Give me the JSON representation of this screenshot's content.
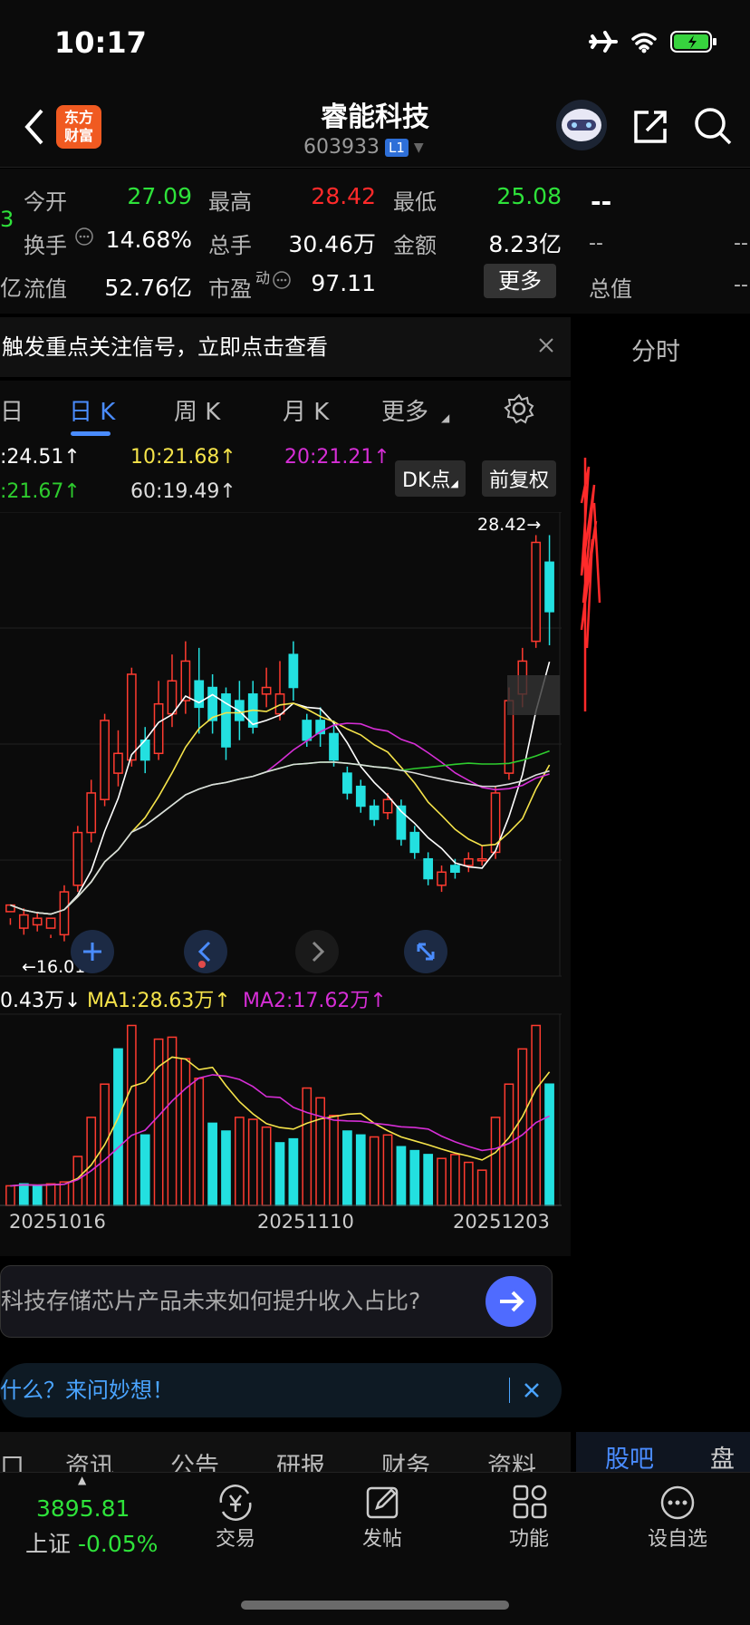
{
  "status": {
    "time": "10:17"
  },
  "header": {
    "logo_line1": "东方",
    "logo_line2": "财富",
    "title": "睿能科技",
    "code": "603933",
    "level_badge": "L1"
  },
  "quote": {
    "open_label": "今开",
    "open": "27.09",
    "high_label": "最高",
    "high": "28.42",
    "low_label": "最低",
    "low": "25.08",
    "turnover_label": "换手",
    "turnover": "14.68%",
    "volume_label": "总手",
    "volume": "30.46万",
    "amount_label": "金额",
    "amount": "8.23亿",
    "float_label": "流值",
    "float_value": "52.76亿",
    "pe_label": "市盈",
    "pe_sup": "动",
    "pe": "97.11",
    "more_label": "更多",
    "left_edge_1": "3",
    "left_edge_2": "亿",
    "side_dash": "--",
    "side_dash2": "--",
    "side_total_label": "总值",
    "side_dash3": "--",
    "side_dash4": "--"
  },
  "banner": {
    "text": "触发重点关注信号，立即点击查看"
  },
  "tabs": {
    "t0": "日",
    "t1": "日 K",
    "t2": "周 K",
    "t3": "月 K",
    "t4": "更多",
    "side": "分时"
  },
  "ma": {
    "ma5": ":24.51↑",
    "ma10": "10:21.68↑",
    "ma20": "20:21.21↑",
    "ma30": ":21.67↑",
    "ma60": "60:19.49↑",
    "dk": "DK点",
    "fq": "前复权"
  },
  "chart": {
    "max_label": "28.42→",
    "min_label": "←16.01",
    "vol_ma0": "0.43万↓",
    "vol_ma1": "MA1:28.63万↑",
    "vol_ma2": "MA2:17.62万↑",
    "date1": "20251016",
    "date2": "20251110",
    "date3": "20251203"
  },
  "chart_data": {
    "type": "candlestick",
    "price_high": 28.42,
    "price_low": 16.01,
    "candles": [
      [
        17.0,
        17.2,
        16.8,
        16.6
      ],
      [
        16.5,
        16.9,
        17.1,
        16.3
      ],
      [
        16.6,
        16.8,
        17.0,
        16.4
      ],
      [
        16.5,
        16.8,
        16.2,
        16.3
      ],
      [
        16.3,
        17.6,
        17.8,
        16.1
      ],
      [
        17.8,
        19.4,
        19.6,
        17.6
      ],
      [
        19.4,
        20.6,
        21.0,
        19.1
      ],
      [
        20.4,
        22.8,
        23.0,
        20.2
      ],
      [
        21.2,
        21.8,
        22.5,
        20.8
      ],
      [
        21.6,
        24.2,
        24.4,
        21.4
      ],
      [
        22.2,
        21.6,
        22.6,
        21.2
      ],
      [
        21.8,
        23.3,
        24.0,
        21.6
      ],
      [
        23.0,
        24.0,
        24.8,
        22.6
      ],
      [
        23.4,
        24.6,
        25.2,
        23.0
      ],
      [
        24.0,
        23.2,
        25.0,
        22.4
      ],
      [
        23.8,
        22.8,
        24.2,
        22.4
      ],
      [
        23.6,
        22.0,
        23.8,
        21.6
      ],
      [
        23.4,
        22.8,
        24.0,
        22.2
      ],
      [
        23.6,
        22.6,
        24.0,
        22.4
      ],
      [
        23.6,
        23.8,
        24.4,
        23.2
      ],
      [
        23.0,
        23.6,
        24.6,
        22.8
      ],
      [
        24.8,
        23.8,
        25.2,
        23.4
      ],
      [
        22.8,
        22.2,
        23.0,
        22.0
      ],
      [
        22.8,
        22.4,
        23.2,
        22.0
      ],
      [
        22.4,
        21.6,
        22.8,
        21.4
      ],
      [
        21.2,
        20.6,
        21.4,
        20.4
      ],
      [
        20.8,
        20.2,
        21.0,
        20.0
      ],
      [
        20.2,
        19.8,
        20.4,
        19.6
      ],
      [
        20.0,
        20.4,
        20.6,
        19.8
      ],
      [
        20.2,
        19.2,
        20.4,
        19.0
      ],
      [
        19.4,
        18.8,
        19.6,
        18.6
      ],
      [
        18.6,
        18.0,
        18.8,
        17.8
      ],
      [
        17.8,
        18.2,
        18.4,
        17.6
      ],
      [
        18.4,
        18.2,
        18.6,
        18.0
      ],
      [
        18.4,
        18.6,
        18.8,
        18.2
      ],
      [
        18.6,
        18.6,
        19.0,
        18.4
      ],
      [
        18.8,
        20.6,
        20.8,
        18.6
      ],
      [
        21.2,
        23.4,
        23.8,
        21.0
      ],
      [
        23.6,
        24.6,
        25.0,
        23.2
      ],
      [
        25.2,
        28.2,
        28.42,
        25.0
      ],
      [
        27.6,
        26.1,
        28.42,
        25.08
      ]
    ],
    "volume": [
      [
        10,
        "up"
      ],
      [
        11,
        "down"
      ],
      [
        10,
        "down"
      ],
      [
        11,
        "up"
      ],
      [
        12,
        "up"
      ],
      [
        25,
        "up"
      ],
      [
        45,
        "up"
      ],
      [
        62,
        "up"
      ],
      [
        80,
        "down"
      ],
      [
        92,
        "up"
      ],
      [
        36,
        "down"
      ],
      [
        85,
        "up"
      ],
      [
        86,
        "up"
      ],
      [
        75,
        "up"
      ],
      [
        65,
        "up"
      ],
      [
        42,
        "down"
      ],
      [
        38,
        "down"
      ],
      [
        45,
        "up"
      ],
      [
        44,
        "up"
      ],
      [
        40,
        "up"
      ],
      [
        32,
        "down"
      ],
      [
        34,
        "down"
      ],
      [
        60,
        "up"
      ],
      [
        55,
        "up"
      ],
      [
        46,
        "up"
      ],
      [
        38,
        "down"
      ],
      [
        36,
        "down"
      ],
      [
        35,
        "up"
      ],
      [
        36,
        "up"
      ],
      [
        30,
        "down"
      ],
      [
        28,
        "down"
      ],
      [
        26,
        "down"
      ],
      [
        24,
        "up"
      ],
      [
        26,
        "up"
      ],
      [
        22,
        "up"
      ],
      [
        18,
        "up"
      ],
      [
        45,
        "up"
      ],
      [
        62,
        "up"
      ],
      [
        80,
        "up"
      ],
      [
        92,
        "up"
      ],
      [
        62,
        "down"
      ]
    ]
  },
  "ask": {
    "text": "科技存储芯片产品未来如何提升收入占比?"
  },
  "hint": {
    "text": "什么？来问妙想！"
  },
  "subtabs": {
    "s0": "口",
    "s1": "资讯",
    "s2": "公告",
    "s3": "研报",
    "s4": "财务",
    "s5": "资料",
    "s6": "股吧",
    "s7": "盘口"
  },
  "bottom": {
    "index_value": "3895.81",
    "index_name": "上证",
    "index_change": "-0.05%",
    "trade": "交易",
    "post": "发帖",
    "func": "功能",
    "watch": "设自选"
  }
}
